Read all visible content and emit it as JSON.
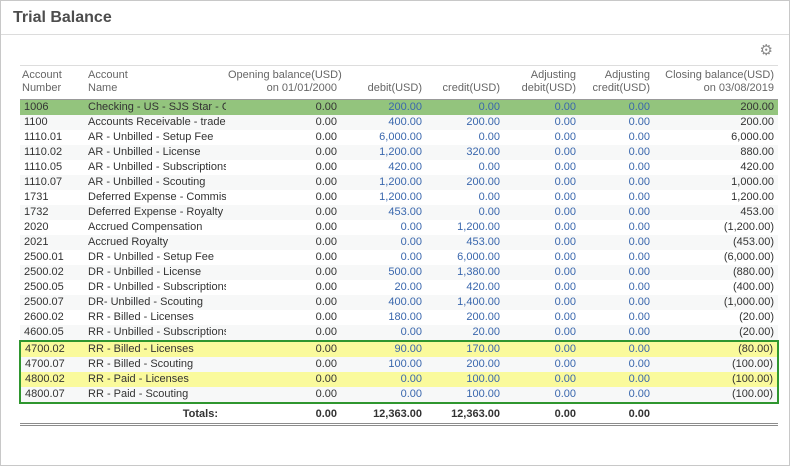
{
  "page": {
    "title": "Trial Balance"
  },
  "toolbar": {
    "settings_icon": "⚙"
  },
  "colors": {
    "green_highlight": "#93c47d",
    "yellow_highlight": "#fafa9c",
    "red_highlight": "#ea9999",
    "green_box_border": "#2f962f",
    "amount_link_blue": "#3a67ad"
  },
  "table": {
    "columns": [
      {
        "line1": "Account",
        "line2": "Number",
        "align": "left"
      },
      {
        "line1": "Account",
        "line2": "Name",
        "align": "left"
      },
      {
        "line1": "Opening balance(USD)",
        "line2": "on 01/01/2000",
        "align": "right"
      },
      {
        "line1": "",
        "line2": "debit(USD)",
        "align": "right"
      },
      {
        "line1": "",
        "line2": "credit(USD)",
        "align": "right"
      },
      {
        "line1": "Adjusting",
        "line2": "debit(USD)",
        "align": "right"
      },
      {
        "line1": "Adjusting",
        "line2": "credit(USD)",
        "align": "right"
      },
      {
        "line1": "Closing balance(USD)",
        "line2": "on 03/08/2019",
        "align": "right"
      }
    ],
    "rows": [
      {
        "number": "1006",
        "name": "Checking - US - SJS Star - One",
        "opening": "0.00",
        "debit": "200.00",
        "credit": "0.00",
        "adj_debit": "0.00",
        "adj_credit": "0.00",
        "closing": "200.00",
        "highlight": "green",
        "box": false
      },
      {
        "number": "1100",
        "name": "Accounts Receivable - trade",
        "opening": "0.00",
        "debit": "400.00",
        "credit": "200.00",
        "adj_debit": "0.00",
        "adj_credit": "0.00",
        "closing": "200.00",
        "highlight": "green",
        "box": false
      },
      {
        "number": "1110.01",
        "name": "AR - Unbilled - Setup Fee",
        "opening": "0.00",
        "debit": "6,000.00",
        "credit": "0.00",
        "adj_debit": "0.00",
        "adj_credit": "0.00",
        "closing": "6,000.00",
        "highlight": "",
        "box": false
      },
      {
        "number": "1110.02",
        "name": "AR - Unbilled - License",
        "opening": "0.00",
        "debit": "1,200.00",
        "credit": "320.00",
        "adj_debit": "0.00",
        "adj_credit": "0.00",
        "closing": "880.00",
        "highlight": "",
        "box": false
      },
      {
        "number": "1110.05",
        "name": "AR - Unbilled - Subscriptions",
        "opening": "0.00",
        "debit": "420.00",
        "credit": "0.00",
        "adj_debit": "0.00",
        "adj_credit": "0.00",
        "closing": "420.00",
        "highlight": "",
        "box": false
      },
      {
        "number": "1110.07",
        "name": "AR - Unbilled - Scouting",
        "opening": "0.00",
        "debit": "1,200.00",
        "credit": "200.00",
        "adj_debit": "0.00",
        "adj_credit": "0.00",
        "closing": "1,000.00",
        "highlight": "",
        "box": false
      },
      {
        "number": "1731",
        "name": "Deferred Expense - Commision",
        "opening": "0.00",
        "debit": "1,200.00",
        "credit": "0.00",
        "adj_debit": "0.00",
        "adj_credit": "0.00",
        "closing": "1,200.00",
        "highlight": "",
        "box": false
      },
      {
        "number": "1732",
        "name": "Deferred Expense - Royalty",
        "opening": "0.00",
        "debit": "453.00",
        "credit": "0.00",
        "adj_debit": "0.00",
        "adj_credit": "0.00",
        "closing": "453.00",
        "highlight": "",
        "box": false
      },
      {
        "number": "2020",
        "name": "Accrued Compensation",
        "opening": "0.00",
        "debit": "0.00",
        "credit": "1,200.00",
        "adj_debit": "0.00",
        "adj_credit": "0.00",
        "closing": "(1,200.00)",
        "highlight": "",
        "box": false
      },
      {
        "number": "2021",
        "name": "Accrued Royalty",
        "opening": "0.00",
        "debit": "0.00",
        "credit": "453.00",
        "adj_debit": "0.00",
        "adj_credit": "0.00",
        "closing": "(453.00)",
        "highlight": "",
        "box": false
      },
      {
        "number": "2500.01",
        "name": "DR - Unbilled - Setup Fee",
        "opening": "0.00",
        "debit": "0.00",
        "credit": "6,000.00",
        "adj_debit": "0.00",
        "adj_credit": "0.00",
        "closing": "(6,000.00)",
        "highlight": "",
        "box": false
      },
      {
        "number": "2500.02",
        "name": "DR - Unbilled - License",
        "opening": "0.00",
        "debit": "500.00",
        "credit": "1,380.00",
        "adj_debit": "0.00",
        "adj_credit": "0.00",
        "closing": "(880.00)",
        "highlight": "",
        "box": false
      },
      {
        "number": "2500.05",
        "name": "DR - Unbilled - Subscriptions",
        "opening": "0.00",
        "debit": "20.00",
        "credit": "420.00",
        "adj_debit": "0.00",
        "adj_credit": "0.00",
        "closing": "(400.00)",
        "highlight": "",
        "box": false
      },
      {
        "number": "2500.07",
        "name": "DR- Unbilled - Scouting",
        "opening": "0.00",
        "debit": "400.00",
        "credit": "1,400.00",
        "adj_debit": "0.00",
        "adj_credit": "0.00",
        "closing": "(1,000.00)",
        "highlight": "",
        "box": false
      },
      {
        "number": "2600.02",
        "name": "RR - Billed - Licenses",
        "opening": "0.00",
        "debit": "180.00",
        "credit": "200.00",
        "adj_debit": "0.00",
        "adj_credit": "0.00",
        "closing": "(20.00)",
        "highlight": "",
        "box": false
      },
      {
        "number": "4600.05",
        "name": "RR - Unbilled - Subscriptions",
        "opening": "0.00",
        "debit": "0.00",
        "credit": "20.00",
        "adj_debit": "0.00",
        "adj_credit": "0.00",
        "closing": "(20.00)",
        "highlight": "",
        "box": false
      },
      {
        "number": "4700.02",
        "name": "RR - Billed - Licenses",
        "opening": "0.00",
        "debit": "90.00",
        "credit": "170.00",
        "adj_debit": "0.00",
        "adj_credit": "0.00",
        "closing": "(80.00)",
        "highlight": "yellow",
        "box": true
      },
      {
        "number": "4700.07",
        "name": "RR - Billed - Scouting",
        "opening": "0.00",
        "debit": "100.00",
        "credit": "200.00",
        "adj_debit": "0.00",
        "adj_credit": "0.00",
        "closing": "(100.00)",
        "highlight": "red",
        "box": true
      },
      {
        "number": "4800.02",
        "name": "RR - Paid - Licenses",
        "opening": "0.00",
        "debit": "0.00",
        "credit": "100.00",
        "adj_debit": "0.00",
        "adj_credit": "0.00",
        "closing": "(100.00)",
        "highlight": "yellow",
        "box": true
      },
      {
        "number": "4800.07",
        "name": "RR - Paid - Scouting",
        "opening": "0.00",
        "debit": "0.00",
        "credit": "100.00",
        "adj_debit": "0.00",
        "adj_credit": "0.00",
        "closing": "(100.00)",
        "highlight": "red",
        "box": true
      }
    ],
    "totals": {
      "label": "Totals:",
      "opening": "0.00",
      "debit": "12,363.00",
      "credit": "12,363.00",
      "adj_debit": "0.00",
      "adj_credit": "0.00",
      "closing": ""
    }
  }
}
